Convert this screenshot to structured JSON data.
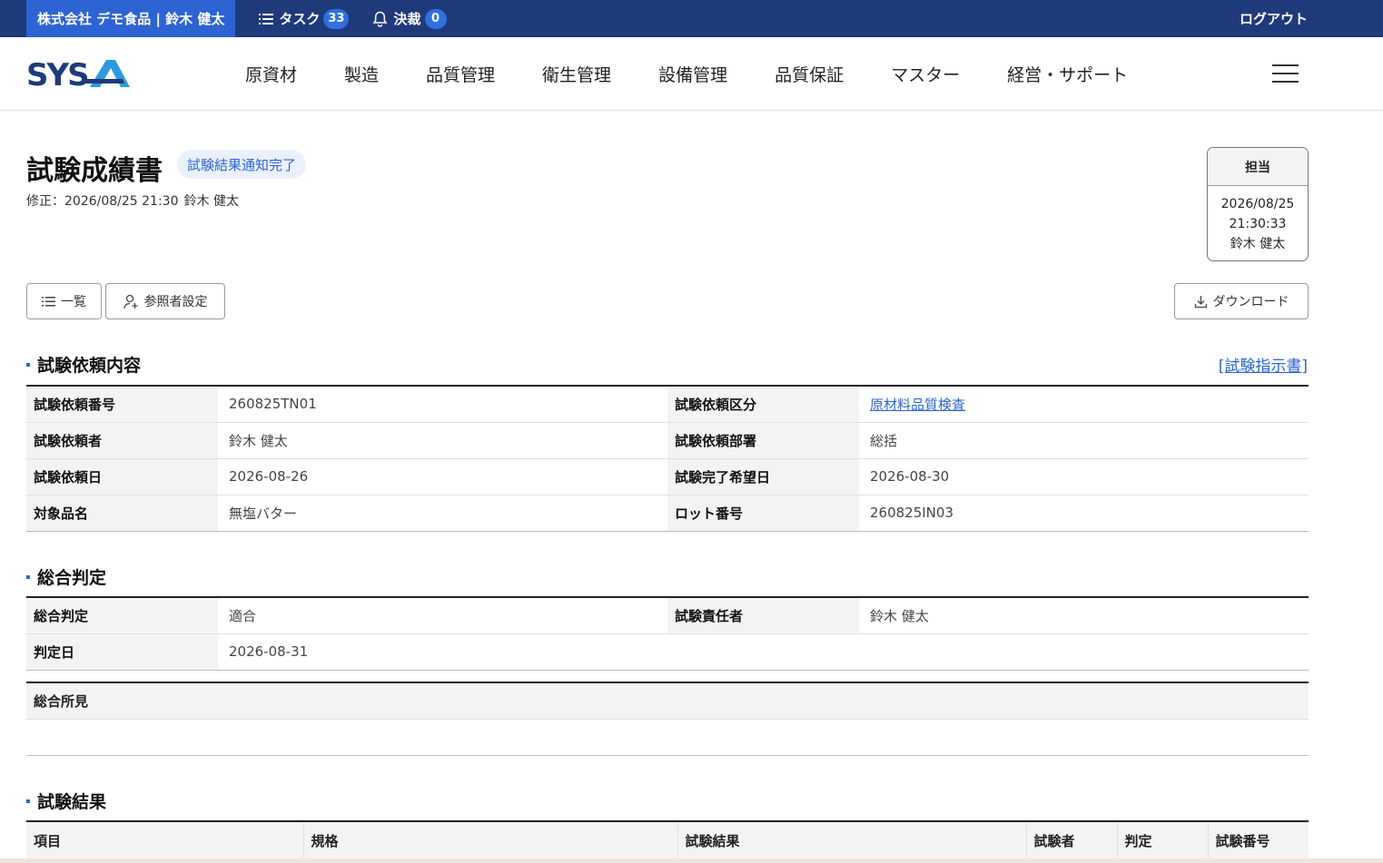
{
  "topbar": {
    "company_user": "株式会社 デモ食品 | 鈴木 健太",
    "task_label": "タスク",
    "task_count": "33",
    "approval_label": "決裁",
    "approval_count": "0",
    "logout": "ログアウト"
  },
  "mainnav": [
    "原資材",
    "製造",
    "品質管理",
    "衛生管理",
    "設備管理",
    "品質保証",
    "マスター",
    "経営・サポート"
  ],
  "page": {
    "title": "試験成績書",
    "status": "試験結果通知完了",
    "modified_label": "修正：2026/08/25 21:30",
    "modified_user": "鈴木 健太"
  },
  "approval_box": {
    "head": "担当",
    "date": "2026/08/25",
    "time": "21:30:33",
    "user": "鈴木 健太"
  },
  "buttons": {
    "list": "一覧",
    "viewers": "参照者設定",
    "download": "ダウンロード"
  },
  "request_section": {
    "title": "試験依頼内容",
    "instruction_link": "[試験指示書]",
    "rows": [
      [
        "試験依頼番号",
        "260825TN01",
        "試験依頼区分",
        "原材料品質検査"
      ],
      [
        "試験依頼者",
        "鈴木 健太",
        "試験依頼部署",
        "総括"
      ],
      [
        "試験依頼日",
        "2026-08-26",
        "試験完了希望日",
        "2026-08-30"
      ],
      [
        "対象品名",
        "無塩バター",
        "ロット番号",
        "260825IN03"
      ]
    ]
  },
  "judgement_section": {
    "title": "総合判定",
    "rows": [
      [
        "総合判定",
        "適合",
        "試験責任者",
        "鈴木 健太"
      ],
      [
        "判定日",
        "2026-08-31",
        "",
        ""
      ]
    ],
    "remarks_label": "総合所見",
    "remarks_value": ""
  },
  "results_section": {
    "title": "試験結果",
    "columns": [
      "項目",
      "規格",
      "試験結果",
      "試験者",
      "判定",
      "試験番号"
    ]
  },
  "colors": {
    "topbar": "#1f3a7a",
    "accent": "#2d63d3"
  }
}
